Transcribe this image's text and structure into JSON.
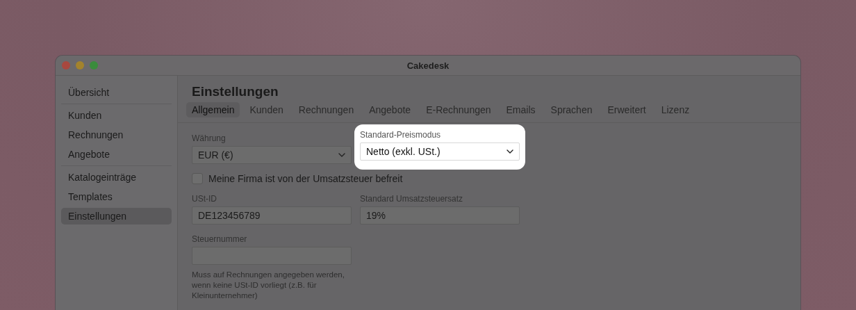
{
  "window": {
    "title": "Cakedesk"
  },
  "sidebar": {
    "groups": [
      [
        {
          "label": "Übersicht",
          "selected": false
        }
      ],
      [
        {
          "label": "Kunden",
          "selected": false
        },
        {
          "label": "Rechnungen",
          "selected": false
        },
        {
          "label": "Angebote",
          "selected": false
        }
      ],
      [
        {
          "label": "Katalogeinträge",
          "selected": false
        },
        {
          "label": "Templates",
          "selected": false
        },
        {
          "label": "Einstellungen",
          "selected": true
        }
      ]
    ]
  },
  "page_title": "Einstellungen",
  "tabs": [
    {
      "label": "Allgemein",
      "selected": true
    },
    {
      "label": "Kunden",
      "selected": false
    },
    {
      "label": "Rechnungen",
      "selected": false
    },
    {
      "label": "Angebote",
      "selected": false
    },
    {
      "label": "E-Rechnungen",
      "selected": false
    },
    {
      "label": "Emails",
      "selected": false
    },
    {
      "label": "Sprachen",
      "selected": false
    },
    {
      "label": "Erweitert",
      "selected": false
    },
    {
      "label": "Lizenz",
      "selected": false
    }
  ],
  "form": {
    "fields": [
      {
        "kind": "select",
        "label": "Währung",
        "value": "EUR (€)",
        "highlighted": false
      },
      {
        "kind": "select",
        "label": "Standard-Preismodus",
        "value": "Netto (exkl. USt.)",
        "highlighted": true
      },
      {
        "kind": "checkbox",
        "label": "Meine Firma ist von der Umsatzsteuer befreit",
        "checked": false
      },
      {
        "kind": "text",
        "label": "USt-ID",
        "value": "DE123456789"
      },
      {
        "kind": "text",
        "label": "Standard Umsatzsteuersatz",
        "value": "19%"
      },
      {
        "kind": "text",
        "label": "Steuernummer",
        "help": "Muss auf Rechnungen angegeben werden, wenn keine USt-ID vorliegt (z.B. für Kleinunternehmer)"
      }
    ]
  }
}
